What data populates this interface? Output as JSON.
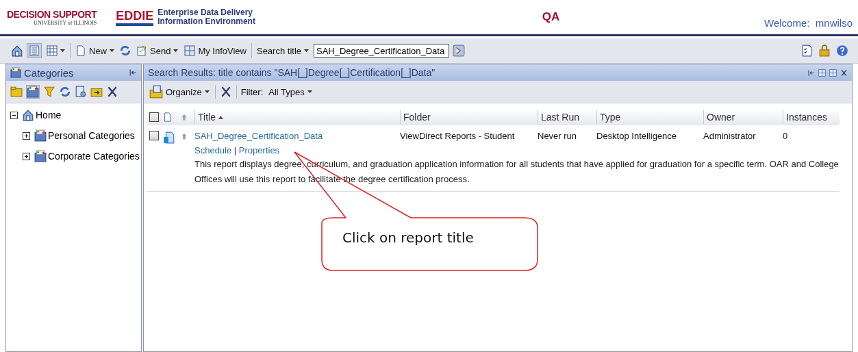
{
  "header": {
    "logo_text": "DECISION SUPPORT",
    "logo_subtext": "UNIVERSITY of ILLINOIS",
    "app_name": "EDDIE",
    "app_subtitle": [
      "Enterprise Data Delivery",
      "Information Environment"
    ],
    "environment": "QA",
    "welcome": "Welcome:  mnwilso"
  },
  "toolbar": {
    "new_label": "New",
    "send_label": "Send",
    "infoview_label": "My InfoView",
    "search_mode": "Search title",
    "search_value": "SAH_Degree_Certification_Data"
  },
  "categories": {
    "title": "Categories",
    "tree": [
      {
        "label": "Home",
        "expanded": true,
        "children": [
          {
            "label": "Personal Categories",
            "expanded": false
          },
          {
            "label": "Corporate Categories",
            "expanded": false
          }
        ]
      }
    ]
  },
  "results": {
    "title": "Search Results: title contains \"SAH[_]Degree[_]Certification[_]Data\"",
    "organize_label": "Organize",
    "filter_label": "Filter:",
    "filter_value": "All Types",
    "select_all_checked": false,
    "columns": [
      {
        "label": "Title",
        "sorted": true
      },
      {
        "label": "Folder",
        "sorted": false
      },
      {
        "label": "Last Run",
        "sorted": false
      },
      {
        "label": "Type",
        "sorted": false
      },
      {
        "label": "Owner",
        "sorted": false
      },
      {
        "label": "Instances",
        "sorted": false
      }
    ],
    "rows": [
      {
        "checked": false,
        "title": "SAH_Degree_Certification_Data",
        "links": [
          "Schedule",
          "Properties"
        ],
        "link_separator": "|",
        "folder": "ViewDirect Reports - Student",
        "last_run": "Never run",
        "type": "Desktop Intelligence",
        "owner": "Administrator",
        "instances": "0",
        "description": "This report displays degree, curriculum, and graduation application information for all students that have applied for graduation for a specific term. OAR and College Offices will use this report to facilitate the degree certification process."
      }
    ]
  },
  "callout": {
    "text": "Click on report title"
  }
}
